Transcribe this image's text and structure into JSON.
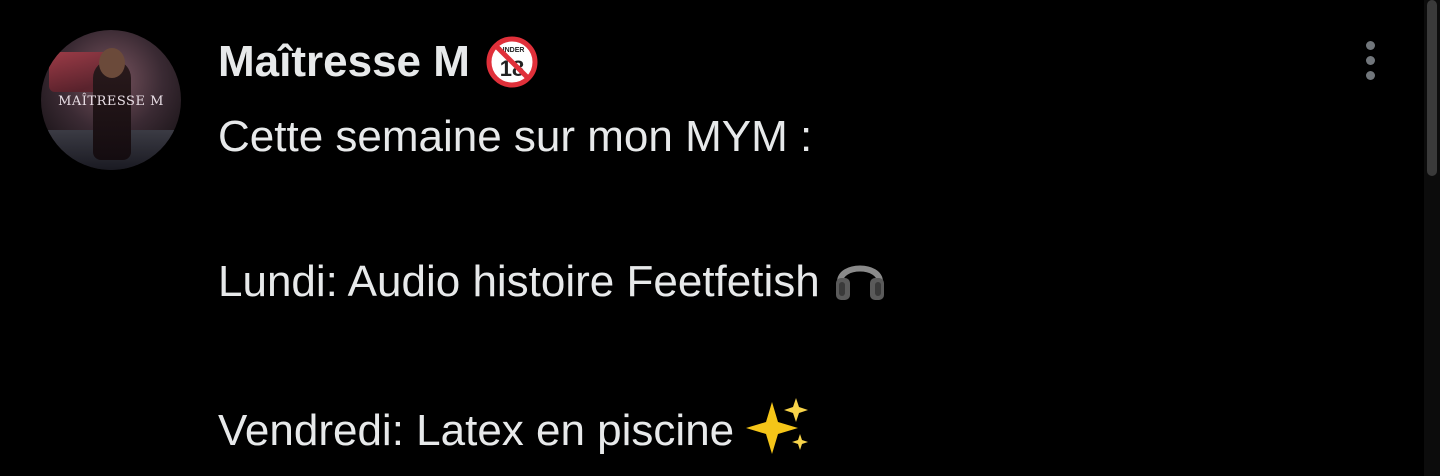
{
  "post": {
    "author": {
      "display_name": "Maîtresse M",
      "badge_icon": "under-18-prohibited-icon",
      "avatar_logo_text": "MAÎTRESSE M"
    },
    "more_icon": "more-vertical-icon",
    "body": {
      "line1": "Cette semaine sur mon MYM :",
      "line2": "Lundi: Audio histoire Feetfetish",
      "line2_emoji": "headphones-icon",
      "line3": "Vendredi: Latex en piscine",
      "line3_emoji": "sparkles-icon"
    }
  },
  "colors": {
    "background": "#000000",
    "text": "#e7e9ea",
    "secondary": "#71767b",
    "badge_red": "#e0303a"
  }
}
